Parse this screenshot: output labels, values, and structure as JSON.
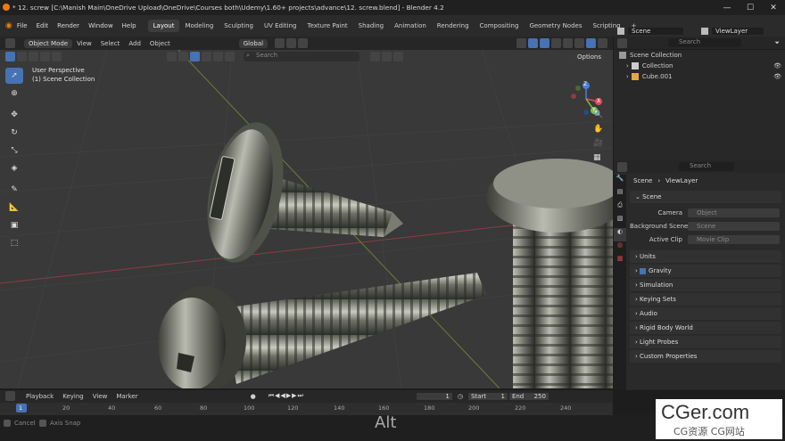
{
  "window": {
    "title": "* 12. screw [C:\\Manish Main\\OneDrive Upload\\OneDrive\\Courses both\\Udemy\\1.60+ projects\\advance\\12. screw.blend] - Blender 4.2"
  },
  "menu": [
    "File",
    "Edit",
    "Render",
    "Window",
    "Help"
  ],
  "workspaces": [
    "Layout",
    "Modeling",
    "Sculpting",
    "UV Editing",
    "Texture Paint",
    "Shading",
    "Animation",
    "Rendering",
    "Compositing",
    "Geometry Nodes",
    "Scripting"
  ],
  "scene": {
    "label": "Scene",
    "viewlayer": "ViewLayer"
  },
  "viewport_header": {
    "mode": "Object Mode",
    "menus": [
      "View",
      "Select",
      "Add",
      "Object"
    ],
    "orientation": "Global",
    "search_placeholder": "Search",
    "options": "Options"
  },
  "viewport_info": {
    "line1": "User Perspective",
    "line2": "(1) Scene Collection"
  },
  "gizmo": {
    "x": "X",
    "y": "Y",
    "z": "Z"
  },
  "outliner": {
    "search_placeholder": "Search",
    "items": [
      "Scene Collection",
      "Collection",
      "Cube.001"
    ]
  },
  "properties": {
    "search_placeholder": "Search",
    "breadcrumb": [
      "Scene",
      "ViewLayer"
    ],
    "section_scene": "Scene",
    "camera_label": "Camera",
    "camera_placeholder": "Object",
    "bg_scene_label": "Background Scene",
    "bg_scene_placeholder": "Scene",
    "active_clip_label": "Active Clip",
    "active_clip_placeholder": "Movie Clip",
    "sections": [
      "Units",
      "Gravity",
      "Simulation",
      "Keying Sets",
      "Audio",
      "Rigid Body World",
      "Light Probes",
      "Custom Properties"
    ]
  },
  "timeline": {
    "menus": [
      "Playback",
      "Keying",
      "View",
      "Marker"
    ],
    "current_frame": "1",
    "start_label": "Start",
    "start": "1",
    "end_label": "End",
    "end": "250",
    "ticks": [
      "1",
      "20",
      "40",
      "60",
      "80",
      "100",
      "120",
      "140",
      "160",
      "180",
      "200",
      "220",
      "240"
    ]
  },
  "statusbar": {
    "cancel": "Cancel",
    "axis_snap": "Axis Snap",
    "key_overlay": "Alt"
  },
  "watermark": {
    "brand": "CGer.com",
    "sub": "CG资源 CG网站"
  },
  "colors": {
    "accent": "#4772b3",
    "x_axis": "#e24a5a",
    "y_axis": "#7ebf3f",
    "z_axis": "#4a7de0"
  }
}
